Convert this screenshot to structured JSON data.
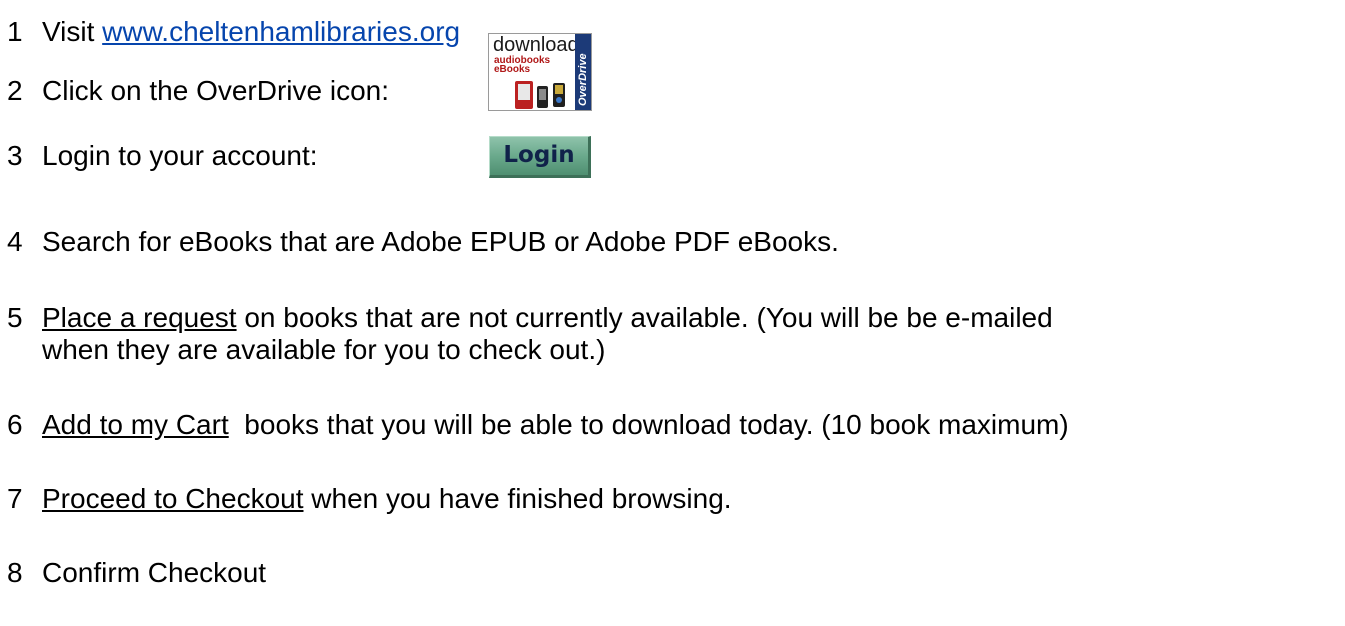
{
  "steps": [
    {
      "number": "1",
      "prefix": "Visit ",
      "link": "www.cheltenhamlibraries.org"
    },
    {
      "number": "2",
      "text": "Click on the OverDrive icon:"
    },
    {
      "number": "3",
      "text": "Login to your account:"
    },
    {
      "number": "4",
      "text": "Search for eBooks that are Adobe EPUB or Adobe PDF eBooks."
    },
    {
      "number": "5",
      "action": "Place a request",
      "rest": " on books that are not currently available. (You will be be e-mailed",
      "line2": "when they are available for you to check out.)"
    },
    {
      "number": "6",
      "action": "Add to my Cart",
      "rest": "  books that you will be able to download today. (10 book maximum)"
    },
    {
      "number": "7",
      "action": "Proceed to Checkout",
      "rest": " when you have finished browsing."
    },
    {
      "number": "8",
      "text": "Confirm Checkout"
    }
  ],
  "overdrive_icon": {
    "word1": "download",
    "word2": "audiobooks",
    "word3": "eBooks",
    "brand": "OverDrive"
  },
  "login_button": {
    "label": "Login"
  }
}
